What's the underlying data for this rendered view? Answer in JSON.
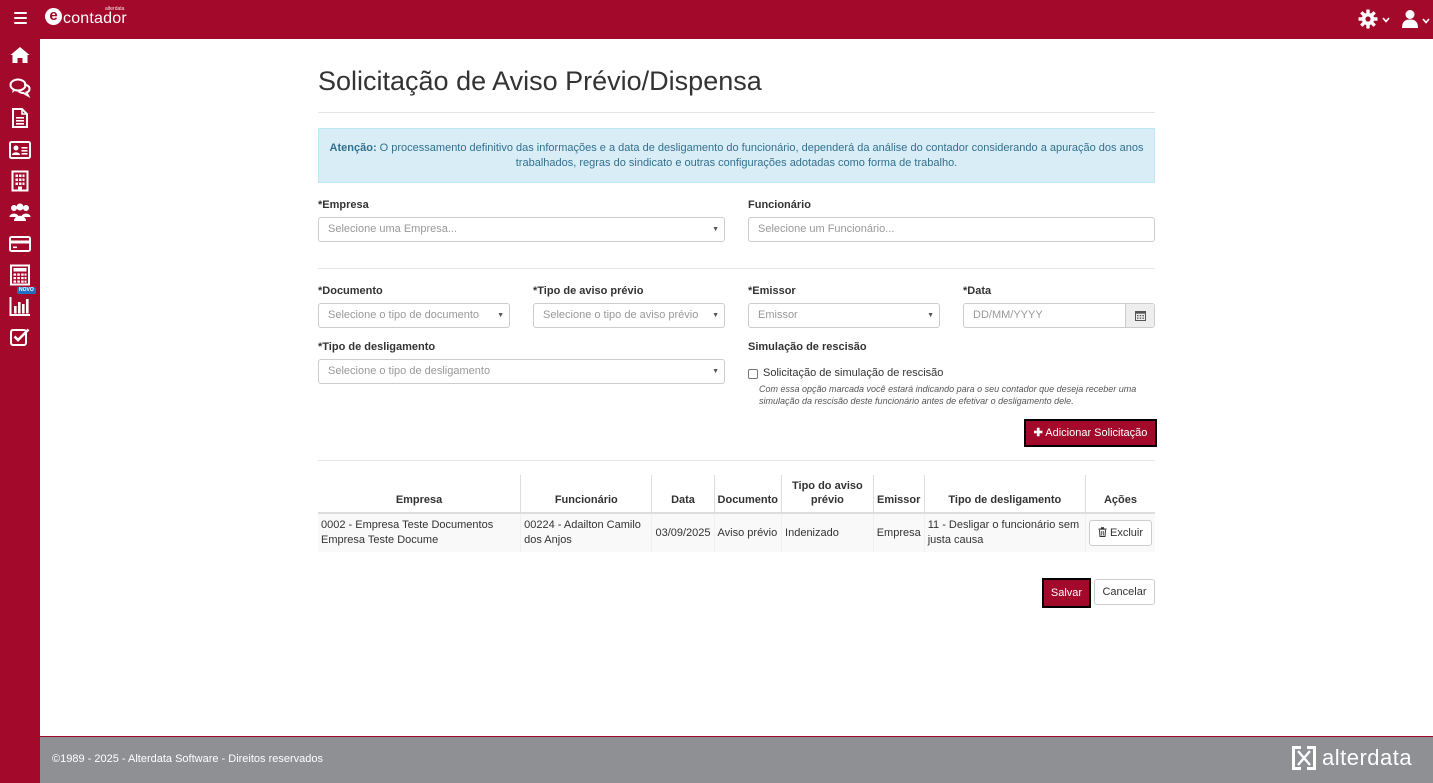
{
  "app": {
    "logo_text": "contador",
    "logo_small": "alterdata",
    "logo_letter": "e"
  },
  "sidebar": {
    "items": [
      {
        "icon": "home-icon"
      },
      {
        "icon": "chat-icon"
      },
      {
        "icon": "document-icon"
      },
      {
        "icon": "id-card-icon"
      },
      {
        "icon": "building-icon"
      },
      {
        "icon": "users-icon"
      },
      {
        "icon": "credit-card-icon"
      },
      {
        "icon": "calculator-icon"
      },
      {
        "icon": "bar-chart-icon",
        "badge": "NOVO"
      },
      {
        "icon": "checklist-icon"
      }
    ]
  },
  "page": {
    "title": "Solicitação de Aviso Prévio/Dispensa",
    "alert_strong": "Atenção:",
    "alert_text": " O processamento definitivo das informações e a data de desligamento do funcionário, dependerá da análise do contador considerando a apuração dos anos trabalhados, regras do sindicato e outras configurações adotadas como forma de trabalho."
  },
  "form": {
    "empresa": {
      "label": "*Empresa",
      "placeholder": "Selecione uma Empresa..."
    },
    "funcionario": {
      "label": "Funcionário",
      "placeholder": "Selecione um Funcionário..."
    },
    "documento": {
      "label": "*Documento",
      "placeholder": "Selecione o tipo de documento"
    },
    "tipo_aviso": {
      "label": "*Tipo de aviso prévio",
      "placeholder": "Selecione o tipo de aviso prévio"
    },
    "emissor": {
      "label": "*Emissor",
      "placeholder": "Emissor"
    },
    "data": {
      "label": "*Data",
      "placeholder": "DD/MM/YYYY"
    },
    "tipo_desligamento": {
      "label": "*Tipo de desligamento",
      "placeholder": "Selecione o tipo de desligamento"
    },
    "simulacao": {
      "label": "Simulação de rescisão",
      "checkbox_label": "Solicitação de simulação de rescisão",
      "checked": false,
      "help": "Com essa opção marcada você estará indicando para o seu contador que deseja receber uma simulação da rescisão deste funcionário antes de efetivar o desligamento dele."
    },
    "add_button": "Adicionar Solicitação"
  },
  "table": {
    "headers": [
      "Empresa",
      "Funcionário",
      "Data",
      "Documento",
      "Tipo do aviso prévio",
      "Emissor",
      "Tipo de desligamento",
      "Ações"
    ],
    "rows": [
      {
        "empresa": "0002 - Empresa Teste Documentos Empresa Teste Docume",
        "funcionario": "00224 - Adailton Camilo dos Anjos",
        "data": "03/09/2025",
        "documento": "Aviso prévio",
        "tipo_aviso": "Indenizado",
        "emissor": "Empresa",
        "tipo_desligamento": "11 - Desligar o funcionário sem justa causa",
        "action": "Excluir"
      }
    ]
  },
  "actions": {
    "save": "Salvar",
    "cancel": "Cancelar"
  },
  "footer": {
    "copyright": "©1989 - 2025 - Alterdata Software - Direitos reservados",
    "brand": "alterdata"
  },
  "colors": {
    "brand": "#a3092a",
    "alert_bg": "#d9edf7",
    "alert_text": "#31708f",
    "footer_bg": "#8e9094"
  }
}
